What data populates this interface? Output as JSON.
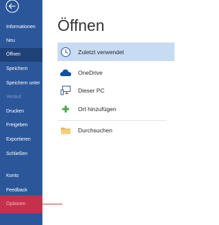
{
  "sidebar": {
    "back_icon": "back-arrow-icon",
    "items": [
      {
        "label": "Informationen",
        "state": "normal"
      },
      {
        "label": "Neu",
        "state": "normal"
      },
      {
        "label": "Öffnen",
        "state": "active"
      },
      {
        "label": "Speichern",
        "state": "normal"
      },
      {
        "label": "Speichern unter",
        "state": "normal"
      },
      {
        "label": "Verlauf",
        "state": "disabled"
      },
      {
        "label": "Drucken",
        "state": "normal"
      },
      {
        "label": "Freigeben",
        "state": "normal"
      },
      {
        "label": "Exportieren",
        "state": "normal"
      },
      {
        "label": "Schließen",
        "state": "normal"
      },
      {
        "label": "Konto",
        "state": "normal"
      },
      {
        "label": "Feedback",
        "state": "normal"
      },
      {
        "label": "Optionen",
        "state": "highlighted"
      }
    ]
  },
  "main": {
    "title": "Öffnen",
    "locations": [
      {
        "label": "Zuletzt verwendet",
        "icon": "clock-icon",
        "selected": true
      },
      {
        "label": "OneDrive",
        "icon": "cloud-icon",
        "selected": false
      },
      {
        "label": "Dieser PC",
        "icon": "computer-icon",
        "selected": false
      },
      {
        "label": "Ort hinzufügen",
        "icon": "plus-icon",
        "selected": false
      },
      {
        "label": "Durchsuchen",
        "icon": "folder-icon",
        "selected": false
      }
    ]
  },
  "colors": {
    "sidebar_bg": "#2b579a",
    "sidebar_active": "#1e4178",
    "highlight": "#c4314b",
    "selected_location": "#c7dcf3",
    "pointer_line": "#d13438"
  }
}
